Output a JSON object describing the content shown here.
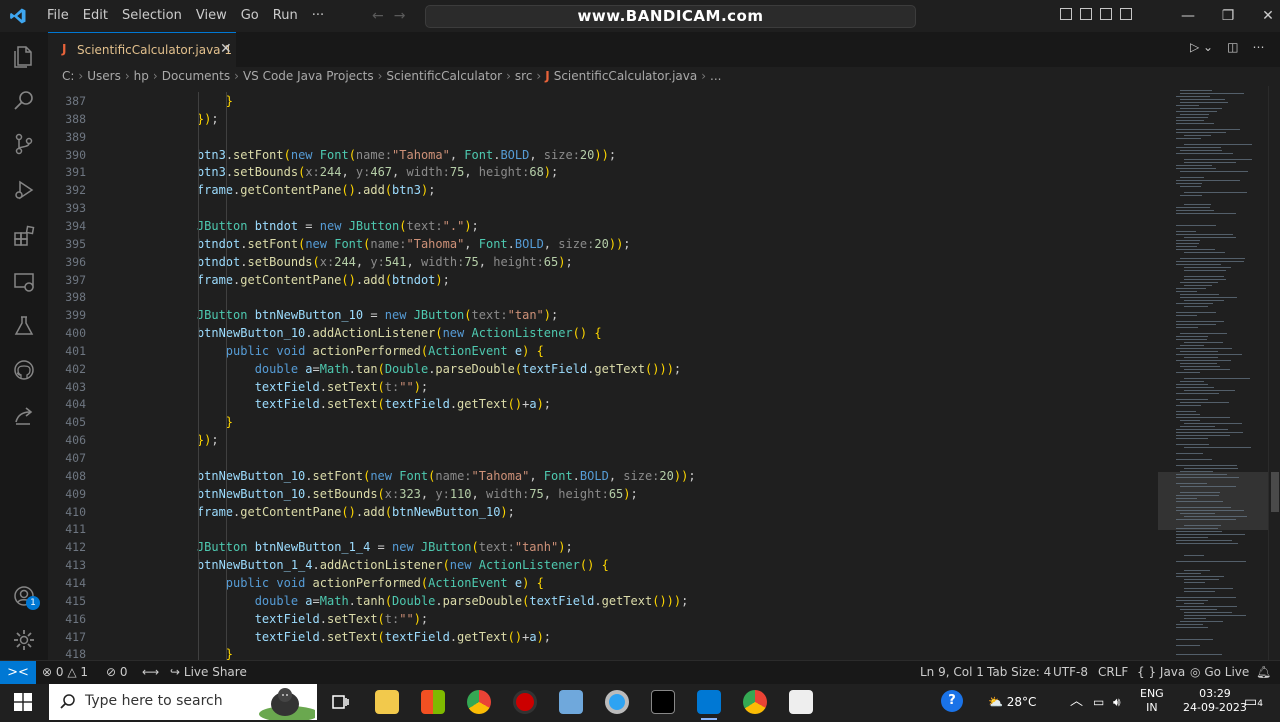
{
  "titlebar": {
    "menus": [
      "File",
      "Edit",
      "Selection",
      "View",
      "Go",
      "Run",
      "···"
    ],
    "search_text": "www.BANDICAM.com",
    "window_controls": [
      "—",
      "❐",
      "✕"
    ]
  },
  "tab": {
    "icon": "J",
    "name": "ScientificCalculator.java",
    "badge": "1",
    "close": "✕"
  },
  "breadcrumb": [
    "C:",
    "Users",
    "hp",
    "Documents",
    "VS Code Java Projects",
    "ScientificCalculator",
    "src",
    "ScientificCalculator.java",
    "..."
  ],
  "editor": {
    "lines": [
      {
        "n": "387",
        "t": "        }"
      },
      {
        "n": "388",
        "t": "    });"
      },
      {
        "n": "389",
        "t": ""
      },
      {
        "n": "390",
        "t": "    btn3.setFont(new Font(name:\"Tahoma\", Font.BOLD, size:20));"
      },
      {
        "n": "391",
        "t": "    btn3.setBounds(x:244, y:467, width:75, height:68);"
      },
      {
        "n": "392",
        "t": "    frame.getContentPane().add(btn3);"
      },
      {
        "n": "393",
        "t": ""
      },
      {
        "n": "394",
        "t": "    JButton btndot = new JButton(text:\".\");"
      },
      {
        "n": "395",
        "t": "    btndot.setFont(new Font(name:\"Tahoma\", Font.BOLD, size:20));"
      },
      {
        "n": "396",
        "t": "    btndot.setBounds(x:244, y:541, width:75, height:65);"
      },
      {
        "n": "397",
        "t": "    frame.getContentPane().add(btndot);"
      },
      {
        "n": "398",
        "t": ""
      },
      {
        "n": "399",
        "t": "    JButton btnNewButton_10 = new JButton(text:\"tan\");"
      },
      {
        "n": "400",
        "t": "    btnNewButton_10.addActionListener(new ActionListener() {"
      },
      {
        "n": "401",
        "t": "        public void actionPerformed(ActionEvent e) {"
      },
      {
        "n": "402",
        "t": "            double a=Math.tan(Double.parseDouble(textField.getText()));"
      },
      {
        "n": "403",
        "t": "            textField.setText(t:\"\");"
      },
      {
        "n": "404",
        "t": "            textField.setText(textField.getText()+a);"
      },
      {
        "n": "405",
        "t": "        }"
      },
      {
        "n": "406",
        "t": "    });"
      },
      {
        "n": "407",
        "t": ""
      },
      {
        "n": "408",
        "t": "    btnNewButton_10.setFont(new Font(name:\"Tahoma\", Font.BOLD, size:20));"
      },
      {
        "n": "409",
        "t": "    btnNewButton_10.setBounds(x:323, y:110, width:75, height:65);"
      },
      {
        "n": "410",
        "t": "    frame.getContentPane().add(btnNewButton_10);"
      },
      {
        "n": "411",
        "t": ""
      },
      {
        "n": "412",
        "t": "    JButton btnNewButton_1_4 = new JButton(text:\"tanh\");"
      },
      {
        "n": "413",
        "t": "    btnNewButton_1_4.addActionListener(new ActionListener() {"
      },
      {
        "n": "414",
        "t": "        public void actionPerformed(ActionEvent e) {"
      },
      {
        "n": "415",
        "t": "            double a=Math.tanh(Double.parseDouble(textField.getText()));"
      },
      {
        "n": "416",
        "t": "            textField.setText(t:\"\");"
      },
      {
        "n": "417",
        "t": "            textField.setText(textField.getText()+a);"
      },
      {
        "n": "418",
        "t": "        }"
      }
    ]
  },
  "activitybar": {
    "account_badge": "1"
  },
  "statusbar": {
    "remote": "><",
    "errors": "0",
    "warnings": "1",
    "info": "0",
    "live_share": "Live Share",
    "position": "Ln 9, Col 1",
    "tab_size": "Tab Size: 4",
    "encoding": "UTF-8",
    "eol": "CRLF",
    "language": "{ } Java",
    "go_live": "Go Live"
  },
  "taskbar": {
    "search_placeholder": "Type here to search",
    "weather": "28°C",
    "lang_1": "ENG",
    "lang_2": "IN",
    "time": "03:29",
    "date": "24-09-2023",
    "notification_count": "4"
  },
  "colors": {
    "accent": "#0078d4",
    "keyword": "#569cd6",
    "type": "#4ec9b0",
    "string": "#ce9178",
    "number": "#b5cea8",
    "method": "#dcdcaa",
    "variable": "#9cdcfe",
    "hint": "#8b8b8b",
    "control": "#c586c0"
  }
}
